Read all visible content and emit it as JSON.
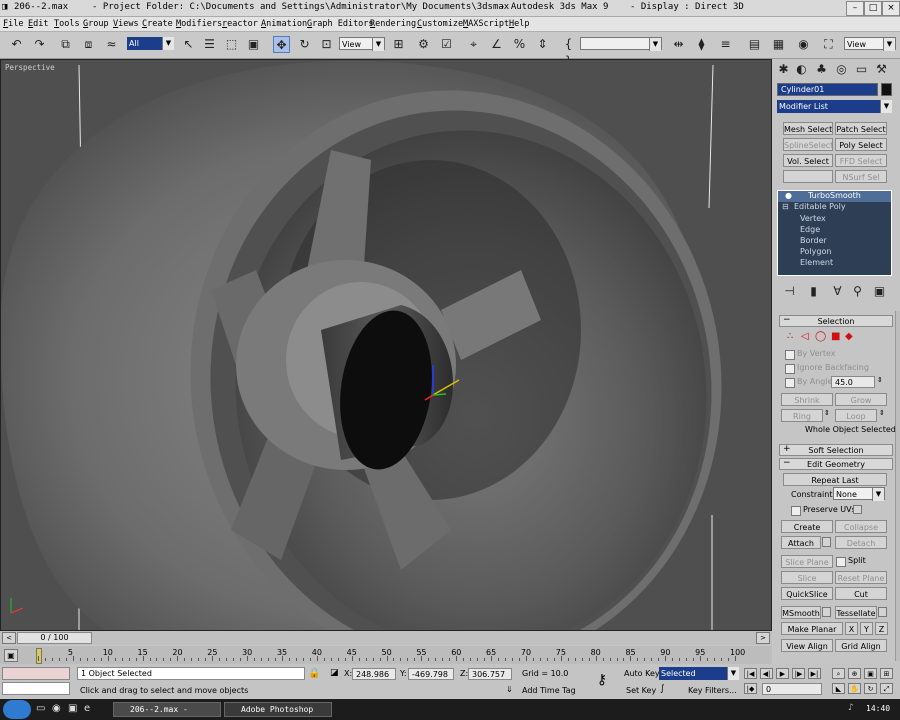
{
  "window": {
    "file": "206--2.max",
    "project_folder": "- Project Folder: C:\\Documents and Settings\\Administrator\\My Documents\\3dsmax",
    "app": "- Autodesk 3ds Max 9",
    "display": "- Display : Direct 3D"
  },
  "menu": [
    "File",
    "Edit",
    "Tools",
    "Group",
    "Views",
    "Create",
    "Modifiers",
    "reactor",
    "Animation",
    "Graph Editors",
    "Rendering",
    "Customize",
    "MAXScript",
    "Help"
  ],
  "toolbar": {
    "selection_filter": "All",
    "ref_coord": "View",
    "named_selection": "",
    "view_dropdown": "View"
  },
  "viewport": {
    "label": "Perspective"
  },
  "command_panel": {
    "object_name": "Cylinder01",
    "modifier_list": "Modifier List",
    "modifier_buttons": [
      {
        "label": "Mesh Select",
        "enabled": true
      },
      {
        "label": "Patch Select",
        "enabled": true
      },
      {
        "label": "SplineSelect",
        "enabled": false
      },
      {
        "label": "Poly Select",
        "enabled": true
      },
      {
        "label": "Vol. Select",
        "enabled": true
      },
      {
        "label": "FFD Select",
        "enabled": false
      },
      {
        "label": "",
        "enabled": false
      },
      {
        "label": "NSurf Sel",
        "enabled": false
      }
    ],
    "stack": {
      "top": "TurboSmooth",
      "base": "Editable Poly",
      "subs": [
        "Vertex",
        "Edge",
        "Border",
        "Polygon",
        "Element"
      ]
    },
    "selection": {
      "title": "Selection",
      "by_vertex": "By Vertex",
      "ignore_backfacing": "Ignore Backfacing",
      "by_angle": "By Angle:",
      "angle": "45.0",
      "shrink": "Shrink",
      "grow": "Grow",
      "ring": "Ring",
      "loop": "Loop",
      "status": "Whole Object Selected"
    },
    "soft_selection": "Soft Selection",
    "edit_geometry": {
      "title": "Edit Geometry",
      "repeat_last": "Repeat Last",
      "constraints": "Constraints:",
      "constraints_value": "None",
      "preserve_uvs": "Preserve UVs",
      "create": "Create",
      "collapse": "Collapse",
      "attach": "Attach",
      "detach": "Detach",
      "slice_plane": "Slice Plane",
      "split": "Split",
      "slice": "Slice",
      "reset_plane": "Reset Plane",
      "quickslice": "QuickSlice",
      "cut": "Cut",
      "msmooth": "MSmooth",
      "tessellate": "Tessellate",
      "make_planar": "Make Planar",
      "x": "X",
      "y": "Y",
      "z": "Z",
      "view_align": "View Align",
      "grid_align": "Grid Align"
    }
  },
  "timeline": {
    "frame_display": "0 / 100",
    "ticks": [
      "0",
      "5",
      "10",
      "15",
      "20",
      "25",
      "30",
      "35",
      "40",
      "45",
      "50",
      "55",
      "60",
      "65",
      "70",
      "75",
      "80",
      "85",
      "90",
      "95",
      "100"
    ]
  },
  "status": {
    "selected": "1 Object Selected",
    "prompt": "Click and drag to select and move objects",
    "x_label": "X:",
    "x": "248.986",
    "y_label": "Y:",
    "y": "-469.798",
    "z_label": "Z:",
    "z": "306.757",
    "grid": "Grid = 10.0",
    "add_time_tag": "Add Time Tag",
    "auto_key": "Auto Key",
    "key_mode": "Selected",
    "set_key": "Set Key",
    "key_filters": "Key Filters...",
    "current_frame": "0"
  },
  "taskbar": {
    "tasks": [
      "206--2.max   -",
      "Adobe Photoshop"
    ],
    "clock": "14:40"
  }
}
